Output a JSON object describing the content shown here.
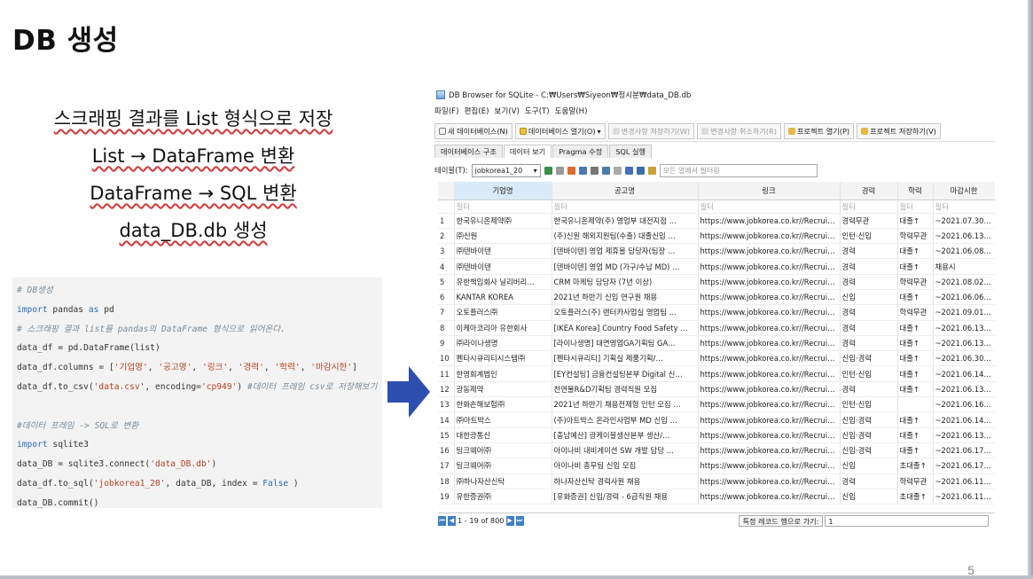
{
  "slide": {
    "title": "DB 생성",
    "page_number": "5",
    "bullets": [
      "스크래핑 결과를 List 형식으로 저장",
      "List → DataFrame 변환",
      "DataFrame → SQL 변환",
      "data_DB.db 생성"
    ]
  },
  "code": {
    "lines": [
      "# DB생성",
      "import pandas as pd",
      "# 스크래핑 결과 list를 pandas의 DataFrame 형식으로 읽어온다.",
      "data_df = pd.DataFrame(list)",
      "data_df.columns = ['기업명', '공고명', '링크', '경력', '학력', '마감시한']",
      "data_df.to_csv('data.csv', encoding='cp949') #데이터 프레임 csv로 저장해보기",
      "",
      "#데이터 프레임 -> SQL로 변환",
      "import sqlite3",
      "data_DB = sqlite3.connect('data_DB.db')",
      "data_df.to_sql('jobkorea1_20', data_DB, index = False )",
      "data_DB.commit()"
    ]
  },
  "window": {
    "title": "DB Browser for SQLite - C:₩Users₩Siyeon₩정시분₩data_DB.db",
    "menu": [
      "파일(F)",
      "편집(E)",
      "보기(V)",
      "도구(T)",
      "도움말(H)"
    ],
    "toolbar": {
      "new_db": "새 데이터베이스(N)",
      "open_db": "데이터베이스 열기(O)",
      "write_changes": "변경사항 저장하기(W)",
      "revert_changes": "변경사항 취소하기(R)",
      "open_project": "프로젝트 열기(P)",
      "save_project": "프로젝트 저장하기(V)"
    },
    "tabs": [
      "데이터베이스 구조",
      "데이터 보기",
      "Pragma 수정",
      "SQL 실행"
    ],
    "active_tab": "데이터 보기",
    "table_label": "테이블(T):",
    "table_name": "jobkorea1_20",
    "filter_all_placeholder": "모든 열에서 필터링",
    "columns": [
      "기업명",
      "공고명",
      "링크",
      "경력",
      "학력",
      "마감시한"
    ],
    "filter_placeholder": "필터",
    "rows": [
      [
        "1",
        "한국유니온제약㈜",
        "한국유니온제약(주) 영업부 대전지점 …",
        "https://www.jobkorea.co.kr//Recruit/…",
        "경력무관",
        "대졸↑",
        "~2021.07.30(금)"
      ],
      [
        "2",
        "㈜신원",
        "(주)신원 해외지원팀(수출) 대졸신입 …",
        "https://www.jobkorea.co.kr//Recruit/…",
        "인턴·신입",
        "학력무관",
        "~2021.06.13(일)"
      ],
      [
        "3",
        "㈜텐바이텐",
        "[텐바이텐] 영업 제휴몰 담당자(팀장 …",
        "https://www.jobkorea.co.kr//Recruit/…",
        "경력",
        "대졸↑",
        "~2021.06.08(화)"
      ],
      [
        "4",
        "㈜텐바이텐",
        "[텐바이텐] 영업 MD (가구/수납 MD) …",
        "https://www.jobkorea.co.kr//Recruit/…",
        "경력",
        "대졸↑",
        "채용시"
      ],
      [
        "5",
        "유한책임회사 닐리버리…",
        "CRM 마케팅 담당자 (7년 이상)",
        "https://www.jobkorea.co.kr//Recruit/…",
        "경력",
        "학력무관",
        "~2021.08.02(월)"
      ],
      [
        "6",
        "KANTAR KOREA",
        "2021년 하반기 신입 연구원 채용",
        "https://www.jobkorea.co.kr//Recruit/…",
        "신입",
        "대졸↑",
        "~2021.06.06(일)"
      ],
      [
        "7",
        "오토플러스㈜",
        "오토플러스(주) 렌터카사업실 영업팀 …",
        "https://www.jobkorea.co.kr//Recruit/…",
        "경력",
        "학력무관",
        "~2021.09.01(수)"
      ],
      [
        "8",
        "이케아코리아 유한회사",
        "[IKEA Korea] Country Food Safety …",
        "https://www.jobkorea.co.kr//Recruit/…",
        "경력",
        "대졸↑",
        "~2021.06.13(일)"
      ],
      [
        "9",
        "㈜라이나생명",
        "[라이나생명] 대면영업GA기획팀 GA…",
        "https://www.jobkorea.co.kr//Recruit/…",
        "경력",
        "대졸↑",
        "~2021.06.13(일)"
      ],
      [
        "10",
        "펜타시큐리티시스템㈜",
        "[펜타시큐리티] 기획실 제품기획/…",
        "https://www.jobkorea.co.kr//Recruit/…",
        "신입·경력",
        "대졸↑",
        "~2021.06.30(수)"
      ],
      [
        "11",
        "한영회계법인",
        "[EY컨설팅] 금융컨설팅본부 Digital 신…",
        "https://www.jobkorea.co.kr//Recruit/…",
        "인턴·신입",
        "대졸↑",
        "~2021.06.14(월)"
      ],
      [
        "12",
        "광동제약",
        "천연물R&D기획팀 경력직원 모집",
        "https://www.jobkorea.co.kr//Recruit/…",
        "경력",
        "대졸↑",
        "~2021.06.13(일)"
      ],
      [
        "13",
        "한화손해보험㈜",
        "2021년 하반기 채용전제형 인턴 모집 …",
        "https://www.jobkorea.co.kr//Recruit/…",
        "인턴·신입",
        "",
        "~2021.06.16(수)"
      ],
      [
        "14",
        "㈜아트박스",
        "(주)아트박스 온라인사업부 MD 신입 …",
        "https://www.jobkorea.co.kr//Recruit/…",
        "신입·경력",
        "대졸↑",
        "~2021.06.14(월)"
      ],
      [
        "15",
        "대한광통신",
        "[충남예산] 광케이블생산본부 생산/…",
        "https://www.jobkorea.co.kr//Recruit/…",
        "신입·경력",
        "대졸↑",
        "~2021.06.13(일)"
      ],
      [
        "16",
        "팅크웨어㈜",
        "아이나비 내비게이션 SW 개발 담당 …",
        "https://www.jobkorea.co.kr//Recruit/…",
        "신입·경력",
        "대졸↑",
        "~2021.06.17(목)"
      ],
      [
        "17",
        "팅크웨어㈜",
        "아이나비 총무팀 신입 모집",
        "https://www.jobkorea.co.kr//Recruit/…",
        "신입",
        "초대졸↑",
        "~2021.06.17(목)"
      ],
      [
        "18",
        "㈜하나자산신탁",
        "하나자산신탁 경력사원 채용",
        "https://www.jobkorea.co.kr//Recruit/…",
        "경력",
        "학력무관",
        "~2021.06.11(금)"
      ],
      [
        "19",
        "유한증권㈜",
        "[유화증권] 신입/경력 - 6급직원 채용",
        "https://www.jobkorea.co.kr//Recruit/…",
        "신입",
        "초대졸↑",
        "~2021.06.11(금)"
      ]
    ],
    "status": {
      "record_range": "1 - 19 of 800",
      "goto_label": "특정 레코드 행으로 가기:",
      "goto_value": "1"
    }
  },
  "colors": {
    "arrow": "#2f4fb0",
    "comment": "#7a8b99",
    "string": "#b7411f",
    "keyword": "#2b6bb8",
    "header_selected": "#d9ebf8"
  }
}
